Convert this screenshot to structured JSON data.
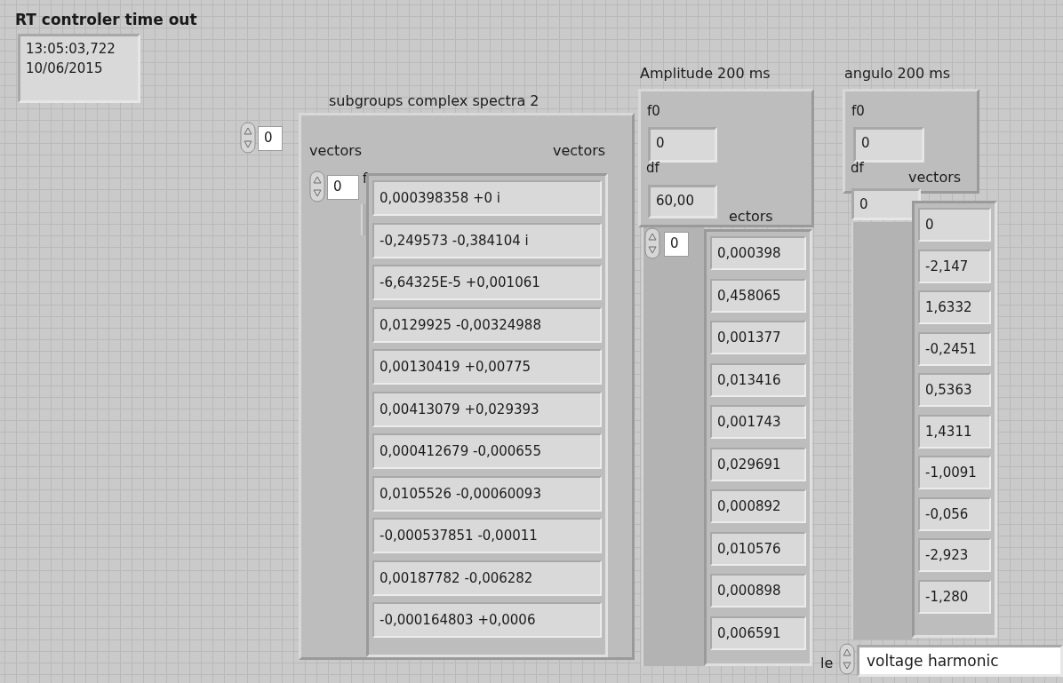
{
  "time_indicator": {
    "label": "RT controler time out",
    "time": "13:05:03,722",
    "date": "10/06/2015"
  },
  "subgroups": {
    "label": "subgroups complex spectra 2",
    "index": "0",
    "left_label": "vectors",
    "right_label": "vectors",
    "inner_index": "0",
    "inner_label": "f",
    "values": [
      "0,000398358 +0 i",
      "-0,249573 -0,384104 i",
      "-6,64325E-5 +0,001061",
      "0,0129925 -0,00324988",
      "0,00130419 +0,00775",
      "0,00413079 +0,029393",
      "0,000412679 -0,000655",
      "0,0105526 -0,00060093",
      "-0,000537851 -0,00011",
      "0,00187782 -0,006282",
      "-0,000164803 +0,0006"
    ]
  },
  "amplitude": {
    "label": "Amplitude 200 ms",
    "f0_label": "f0",
    "f0": "0",
    "df_label": "df",
    "df": "60,00",
    "vectors_label": "ectors",
    "index": "0",
    "values": [
      "0,000398",
      "0,458065",
      "0,001377",
      "0,013416",
      "0,001743",
      "0,029691",
      "0,000892",
      "0,010576",
      "0,000898",
      "0,006591"
    ]
  },
  "angulo": {
    "label": "angulo 200 ms",
    "f0_label": "f0",
    "f0": "0",
    "df_label": "df",
    "df": "0",
    "vectors_label": "vectors",
    "values": [
      "0",
      "-2,147",
      "1,6332",
      "-0,2451",
      "0,5363",
      "1,4311",
      "-1,0091",
      "-0,056",
      "-2,923",
      "-1,280"
    ]
  },
  "group_style": {
    "label": "le",
    "value": "voltage harmonic"
  }
}
